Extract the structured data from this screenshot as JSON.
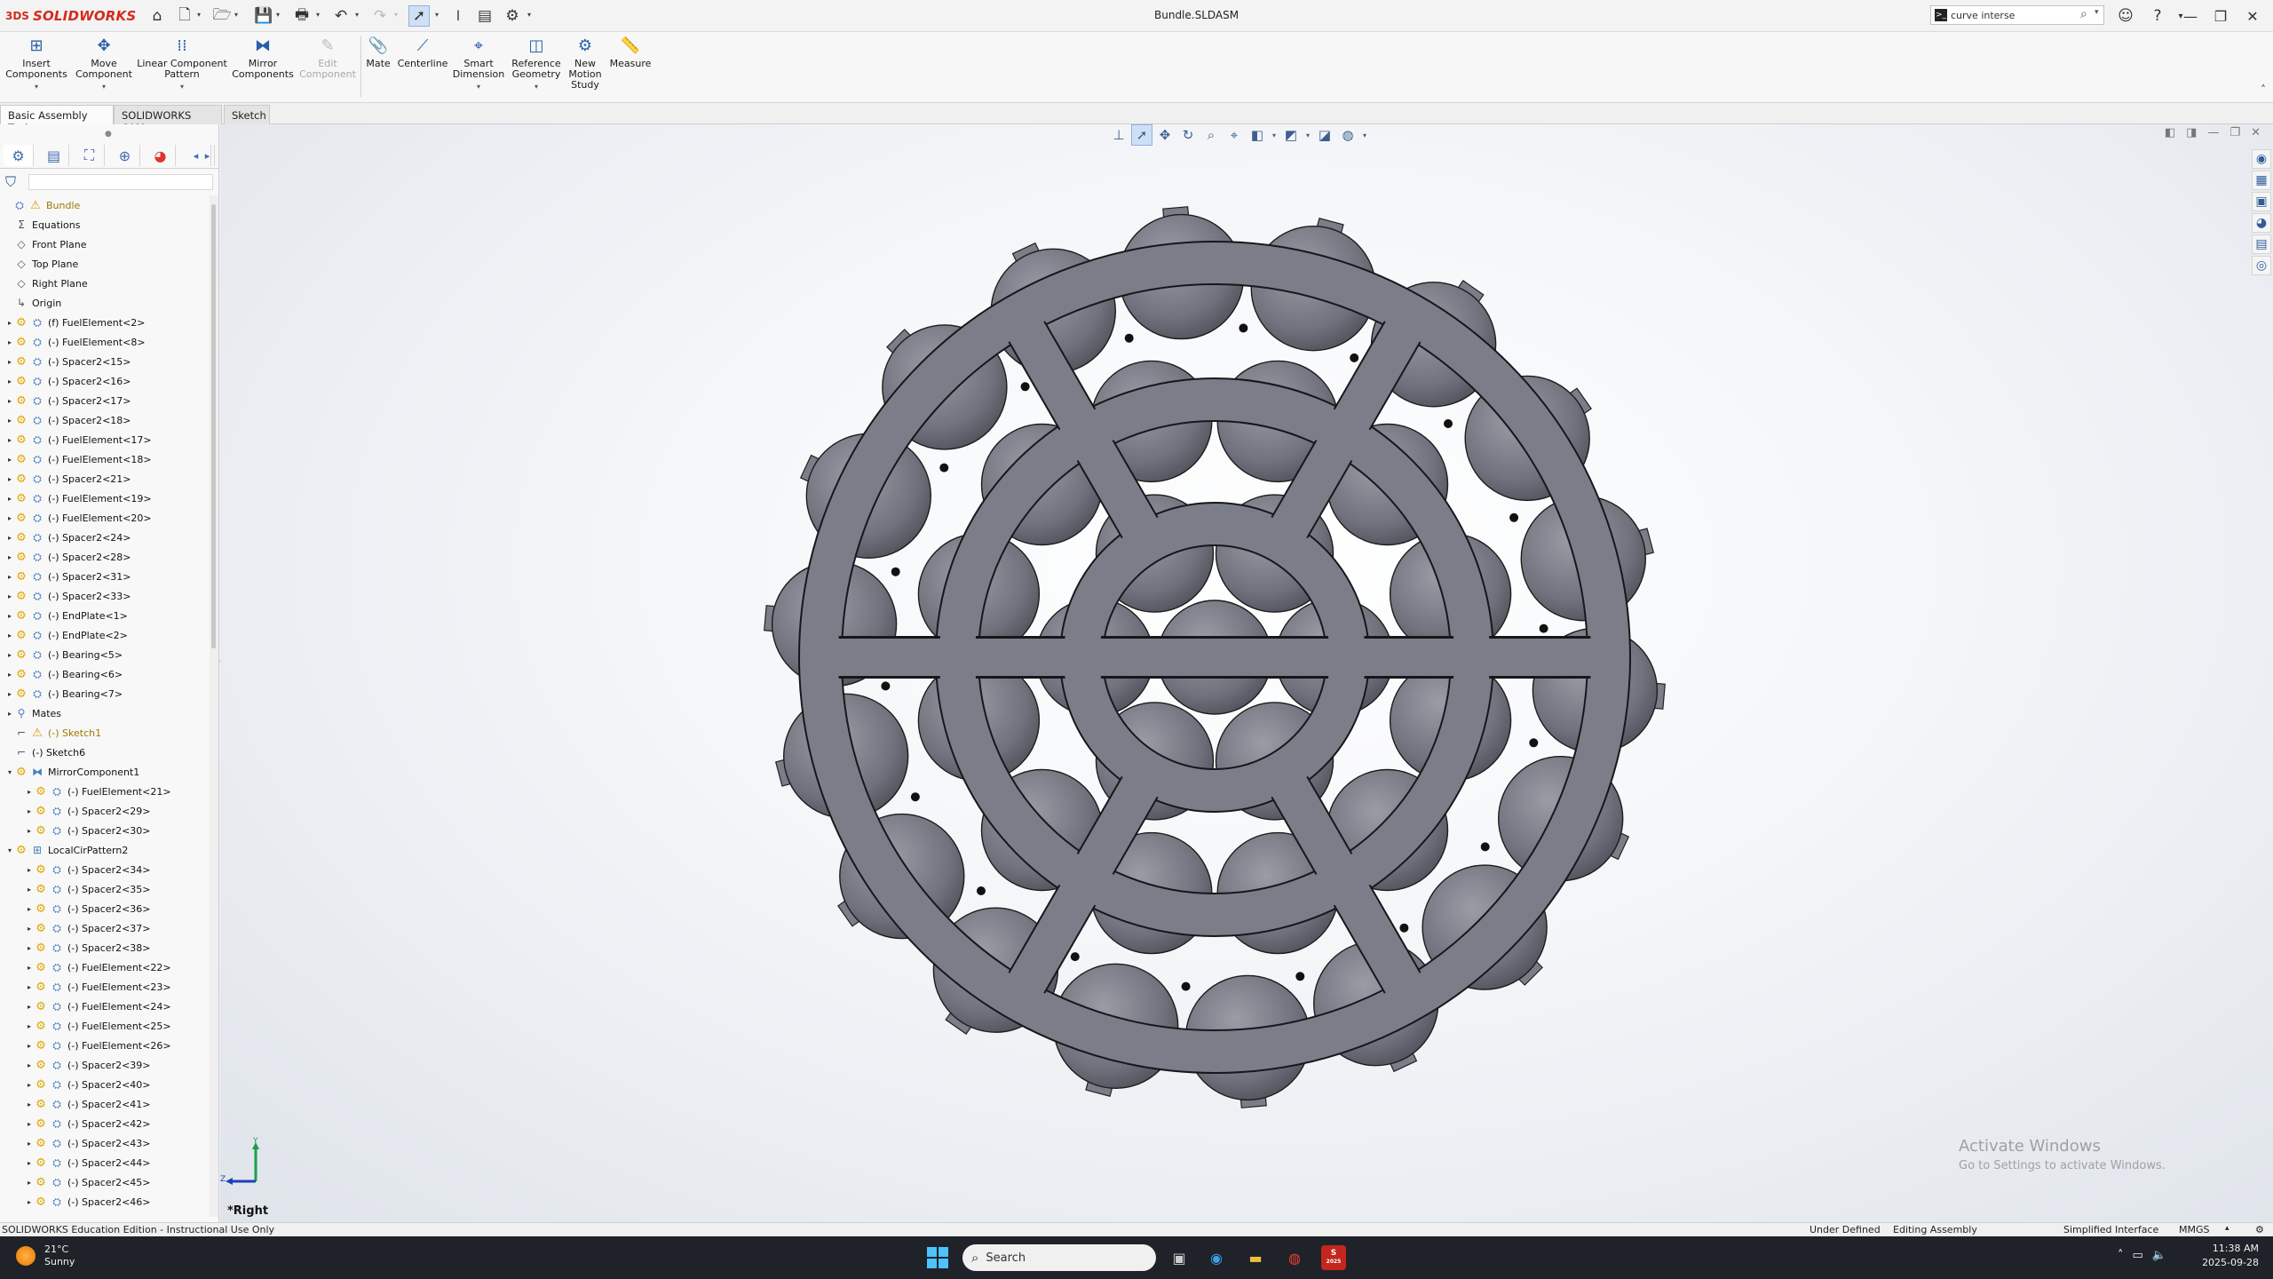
{
  "app": {
    "logo_prefix": "3DS",
    "logo_name": "SOLIDWORKS",
    "document_title": "Bundle.SLDASM",
    "search_value": "curve interse"
  },
  "ribbon": {
    "buttons": [
      {
        "line1": "Insert",
        "line2": "Components",
        "icon": "insert-components-icon",
        "enabled": true
      },
      {
        "line1": "Move",
        "line2": "Component",
        "icon": "move-component-icon",
        "enabled": true
      },
      {
        "line1": "Linear Component",
        "line2": "Pattern",
        "icon": "linear-pattern-icon",
        "enabled": true
      },
      {
        "line1": "Mirror",
        "line2": "Components",
        "icon": "mirror-components-icon",
        "enabled": true
      },
      {
        "line1": "Edit",
        "line2": "Component",
        "icon": "edit-component-icon",
        "enabled": false
      },
      {
        "line1": "Mate",
        "line2": "",
        "icon": "mate-icon",
        "enabled": true
      },
      {
        "line1": "Centerline",
        "line2": "",
        "icon": "centerline-icon",
        "enabled": true
      },
      {
        "line1": "Smart",
        "line2": "Dimension",
        "icon": "smart-dimension-icon",
        "enabled": true
      },
      {
        "line1": "Reference",
        "line2": "Geometry",
        "icon": "reference-geometry-icon",
        "enabled": true
      },
      {
        "line1": "New",
        "line2": "Motion",
        "line3": "Study",
        "icon": "motion-study-icon",
        "enabled": true
      },
      {
        "line1": "Measure",
        "line2": "",
        "icon": "measure-icon",
        "enabled": true
      }
    ]
  },
  "tabs": [
    "Basic Assembly Tools",
    "SOLIDWORKS CAM",
    "Sketch"
  ],
  "tree": [
    {
      "label": "Bundle",
      "depth": 0,
      "type": "root",
      "toggle": ""
    },
    {
      "label": "Equations",
      "depth": 1,
      "type": "equations",
      "toggle": ""
    },
    {
      "label": "Front Plane",
      "depth": 1,
      "type": "plane",
      "toggle": ""
    },
    {
      "label": "Top Plane",
      "depth": 1,
      "type": "plane",
      "toggle": ""
    },
    {
      "label": "Right Plane",
      "depth": 1,
      "type": "plane",
      "toggle": ""
    },
    {
      "label": "Origin",
      "depth": 1,
      "type": "origin",
      "toggle": ""
    },
    {
      "label": "(f) FuelElement<2>",
      "depth": 1,
      "type": "part",
      "toggle": "▸"
    },
    {
      "label": "(-) FuelElement<8>",
      "depth": 1,
      "type": "part",
      "toggle": "▸"
    },
    {
      "label": "(-) Spacer2<15>",
      "depth": 1,
      "type": "part",
      "toggle": "▸"
    },
    {
      "label": "(-) Spacer2<16>",
      "depth": 1,
      "type": "part",
      "toggle": "▸"
    },
    {
      "label": "(-) Spacer2<17>",
      "depth": 1,
      "type": "part",
      "toggle": "▸"
    },
    {
      "label": "(-) Spacer2<18>",
      "depth": 1,
      "type": "part",
      "toggle": "▸"
    },
    {
      "label": "(-) FuelElement<17>",
      "depth": 1,
      "type": "part",
      "toggle": "▸"
    },
    {
      "label": "(-) FuelElement<18>",
      "depth": 1,
      "type": "part",
      "toggle": "▸"
    },
    {
      "label": "(-) Spacer2<21>",
      "depth": 1,
      "type": "part",
      "toggle": "▸"
    },
    {
      "label": "(-) FuelElement<19>",
      "depth": 1,
      "type": "part",
      "toggle": "▸"
    },
    {
      "label": "(-) FuelElement<20>",
      "depth": 1,
      "type": "part",
      "toggle": "▸"
    },
    {
      "label": "(-) Spacer2<24>",
      "depth": 1,
      "type": "part",
      "toggle": "▸"
    },
    {
      "label": "(-) Spacer2<28>",
      "depth": 1,
      "type": "part",
      "toggle": "▸"
    },
    {
      "label": "(-) Spacer2<31>",
      "depth": 1,
      "type": "part",
      "toggle": "▸"
    },
    {
      "label": "(-) Spacer2<33>",
      "depth": 1,
      "type": "part",
      "toggle": "▸"
    },
    {
      "label": "(-) EndPlate<1>",
      "depth": 1,
      "type": "part",
      "toggle": "▸"
    },
    {
      "label": "(-) EndPlate<2>",
      "depth": 1,
      "type": "part",
      "toggle": "▸"
    },
    {
      "label": "(-) Bearing<5>",
      "depth": 1,
      "type": "part",
      "toggle": "▸"
    },
    {
      "label": "(-) Bearing<6>",
      "depth": 1,
      "type": "part",
      "toggle": "▸"
    },
    {
      "label": "(-) Bearing<7>",
      "depth": 1,
      "type": "part",
      "toggle": "▸"
    },
    {
      "label": "Mates",
      "depth": 1,
      "type": "mates",
      "toggle": "▸"
    },
    {
      "label": "(-) Sketch1",
      "depth": 1,
      "type": "sketch-warn",
      "toggle": ""
    },
    {
      "label": "(-) Sketch6",
      "depth": 1,
      "type": "sketch",
      "toggle": ""
    },
    {
      "label": "MirrorComponent1",
      "depth": 1,
      "type": "mirror",
      "toggle": "▾"
    },
    {
      "label": "(-) FuelElement<21>",
      "depth": 2,
      "type": "part",
      "toggle": "▸"
    },
    {
      "label": "(-) Spacer2<29>",
      "depth": 2,
      "type": "part",
      "toggle": "▸"
    },
    {
      "label": "(-) Spacer2<30>",
      "depth": 2,
      "type": "part",
      "toggle": "▸"
    },
    {
      "label": "LocalCirPattern2",
      "depth": 1,
      "type": "pattern",
      "toggle": "▾"
    },
    {
      "label": "(-) Spacer2<34>",
      "depth": 2,
      "type": "part",
      "toggle": "▸"
    },
    {
      "label": "(-) Spacer2<35>",
      "depth": 2,
      "type": "part",
      "toggle": "▸"
    },
    {
      "label": "(-) Spacer2<36>",
      "depth": 2,
      "type": "part",
      "toggle": "▸"
    },
    {
      "label": "(-) Spacer2<37>",
      "depth": 2,
      "type": "part",
      "toggle": "▸"
    },
    {
      "label": "(-) Spacer2<38>",
      "depth": 2,
      "type": "part",
      "toggle": "▸"
    },
    {
      "label": "(-) FuelElement<22>",
      "depth": 2,
      "type": "part",
      "toggle": "▸"
    },
    {
      "label": "(-) FuelElement<23>",
      "depth": 2,
      "type": "part",
      "toggle": "▸"
    },
    {
      "label": "(-) FuelElement<24>",
      "depth": 2,
      "type": "part",
      "toggle": "▸"
    },
    {
      "label": "(-) FuelElement<25>",
      "depth": 2,
      "type": "part",
      "toggle": "▸"
    },
    {
      "label": "(-) FuelElement<26>",
      "depth": 2,
      "type": "part",
      "toggle": "▸"
    },
    {
      "label": "(-) Spacer2<39>",
      "depth": 2,
      "type": "part",
      "toggle": "▸"
    },
    {
      "label": "(-) Spacer2<40>",
      "depth": 2,
      "type": "part",
      "toggle": "▸"
    },
    {
      "label": "(-) Spacer2<41>",
      "depth": 2,
      "type": "part",
      "toggle": "▸"
    },
    {
      "label": "(-) Spacer2<42>",
      "depth": 2,
      "type": "part",
      "toggle": "▸"
    },
    {
      "label": "(-) Spacer2<43>",
      "depth": 2,
      "type": "part",
      "toggle": "▸"
    },
    {
      "label": "(-) Spacer2<44>",
      "depth": 2,
      "type": "part",
      "toggle": "▸"
    },
    {
      "label": "(-) Spacer2<45>",
      "depth": 2,
      "type": "part",
      "toggle": "▸"
    },
    {
      "label": "(-) Spacer2<46>",
      "depth": 2,
      "type": "part",
      "toggle": "▸"
    }
  ],
  "viewport": {
    "view_name": "*Right",
    "watermark_title": "Activate Windows",
    "watermark_sub": "Go to Settings to activate Windows.",
    "triad_labels": {
      "y": "Y",
      "z": "Z"
    },
    "model_color": "#7b7e88"
  },
  "status": {
    "edition": "SOLIDWORKS Education Edition - Instructional Use Only",
    "definition": "Under Defined",
    "mode": "Editing Assembly",
    "interface": "Simplified Interface",
    "units": "MMGS"
  },
  "taskbar": {
    "temperature": "21°C",
    "condition": "Sunny",
    "search_placeholder": "Search",
    "time": "11:38 AM",
    "date": "2025-09-28",
    "sw_badge": "2025"
  }
}
